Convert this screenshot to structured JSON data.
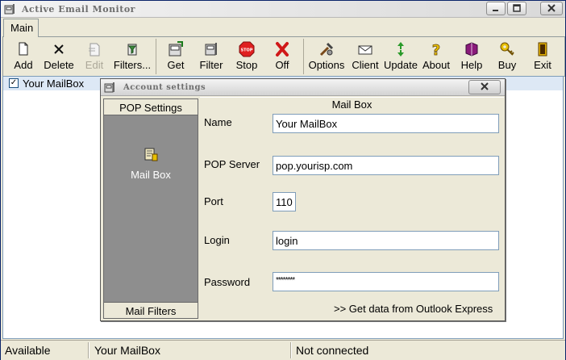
{
  "window": {
    "title": "Active Email Monitor"
  },
  "tabs": [
    {
      "label": "Main"
    }
  ],
  "toolbar": {
    "buttons": [
      {
        "label": "Add",
        "icon": "new-document-icon",
        "enabled": true
      },
      {
        "label": "Delete",
        "icon": "x-mark-icon",
        "enabled": true
      },
      {
        "label": "Edit",
        "icon": "edit-document-icon",
        "enabled": false
      },
      {
        "label": "Filters...",
        "icon": "filter-funnel-icon",
        "enabled": true
      },
      {
        "label": "Get",
        "icon": "get-mail-icon",
        "enabled": true
      },
      {
        "label": "Filter",
        "icon": "mailbox-filter-icon",
        "enabled": true
      },
      {
        "label": "Stop",
        "icon": "stop-sign-icon",
        "enabled": true
      },
      {
        "label": "Off",
        "icon": "red-x-icon",
        "enabled": true
      },
      {
        "label": "Options",
        "icon": "tools-icon",
        "enabled": true
      },
      {
        "label": "Client",
        "icon": "email-client-icon",
        "enabled": true
      },
      {
        "label": "Update",
        "icon": "update-arrows-icon",
        "enabled": true
      },
      {
        "label": "About",
        "icon": "question-icon",
        "enabled": true
      },
      {
        "label": "Help",
        "icon": "help-book-icon",
        "enabled": true
      },
      {
        "label": "Buy",
        "icon": "key-icon",
        "enabled": true
      },
      {
        "label": "Exit",
        "icon": "exit-door-icon",
        "enabled": true
      }
    ]
  },
  "mailbox_list": [
    {
      "label": "Your MailBox",
      "checked": true
    }
  ],
  "status": {
    "state": "Available",
    "mailbox": "Your MailBox",
    "connection": "Not connected"
  },
  "dialog": {
    "title": "Account settings",
    "nav_header": "POP Settings",
    "nav_item": "Mail Box",
    "nav_footer": "Mail Filters",
    "section_title": "Mail Box",
    "fields": {
      "name_label": "Name",
      "name_value": "Your MailBox",
      "server_label": "POP Server",
      "server_value": "pop.yourisp.com",
      "port_label": "Port",
      "port_value": "110",
      "login_label": "Login",
      "login_value": "login",
      "password_label": "Password",
      "password_value": "********"
    },
    "import_link": ">> Get data from Outlook Express"
  },
  "colors": {
    "selection": "#dde8f5",
    "nav_panel": "#8e8e8e",
    "stop_red": "#e02020",
    "face": "#ece9d8"
  }
}
